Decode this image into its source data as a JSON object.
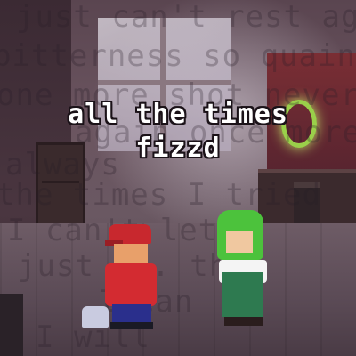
{
  "caption": {
    "song": "all the times",
    "artist": "fizzd"
  },
  "background_lyrics": [
    "just can't rest again",
    "bitterness so quaint",
    "one more shot never",
    "again once more",
    "always",
    "the times I tried",
    "I can't let",
    "just ... the",
    "I can",
    "I will"
  ]
}
